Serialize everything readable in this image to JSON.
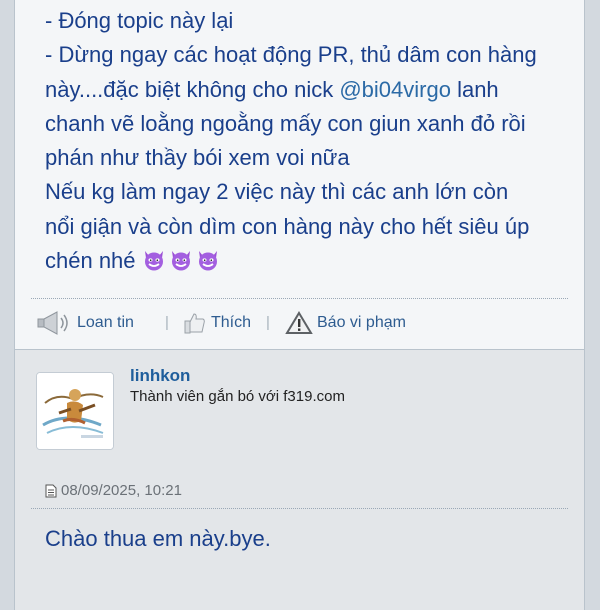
{
  "post1": {
    "lines": [
      "- Đóng topic này lại",
      "- Dừng ngay các hoạt động PR, thủ dâm con hàng",
      "này....đặc biệt không cho nick ",
      "@bi04virgo",
      " lanh",
      "chanh vẽ loằng ngoằng mấy con giun xanh đỏ rồi",
      "phán như thầy bói xem voi nữa",
      "Nếu kg làm ngay 2 việc này thì các anh lớn còn",
      "nổi giận và còn dìm con hàng này cho hết siêu úp",
      "chén nhé "
    ],
    "emojis": [
      "devil-emoji",
      "devil-emoji",
      "devil-emoji"
    ],
    "actions": {
      "share": "Loan tin",
      "like": "Thích",
      "report": "Báo vi phạm",
      "separator": "|"
    }
  },
  "post2": {
    "username": "linhkon",
    "user_title": "Thành viên gắn bó với f319.com",
    "timestamp": "08/09/2025, 10:21",
    "message": "Chào thua em này.bye."
  },
  "colors": {
    "text": "#1a3f8b",
    "link": "#2b6aa6",
    "username": "#1f5e9c",
    "post_bg": "#f4f6f8",
    "reply_bg": "#e3e6e9"
  }
}
